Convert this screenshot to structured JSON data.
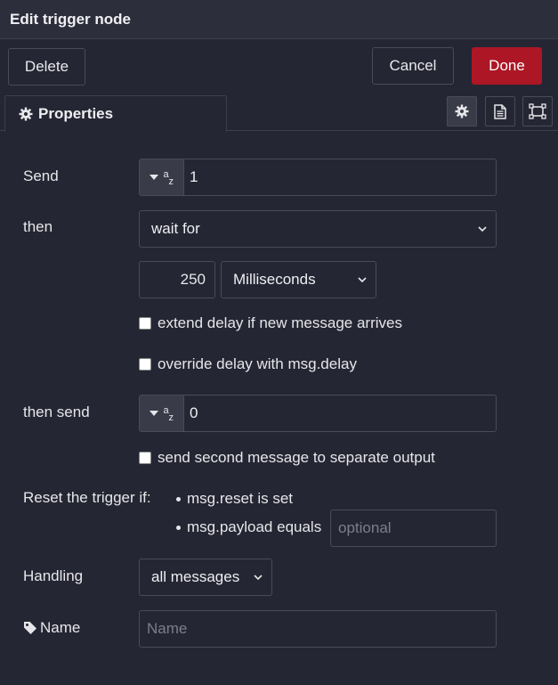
{
  "title": "Edit trigger node",
  "toolbar": {
    "delete_label": "Delete",
    "cancel_label": "Cancel",
    "done_label": "Done",
    "done_color": "#ad1625"
  },
  "tabs": {
    "properties_label": "Properties",
    "icons": [
      "gear-icon",
      "document-icon",
      "frame-icon"
    ]
  },
  "form": {
    "send": {
      "label": "Send",
      "type_icon": "string-type-icon",
      "value": "1"
    },
    "then": {
      "label": "then",
      "selected": "wait for"
    },
    "delay": {
      "value": "250",
      "unit_selected": "Milliseconds"
    },
    "extend_label": "extend delay if new message arrives",
    "override_label": "override delay with msg.delay",
    "then_send": {
      "label": "then send",
      "type_icon": "string-type-icon",
      "value": "0"
    },
    "second_output_label": "send second message to separate output",
    "reset": {
      "label": "Reset the trigger if:",
      "item1": "msg.reset is set",
      "item2": "msg.payload equals",
      "placeholder": "optional"
    },
    "handling": {
      "label": "Handling",
      "selected": "all messages"
    },
    "name": {
      "label": "Name",
      "placeholder": "Name"
    }
  }
}
